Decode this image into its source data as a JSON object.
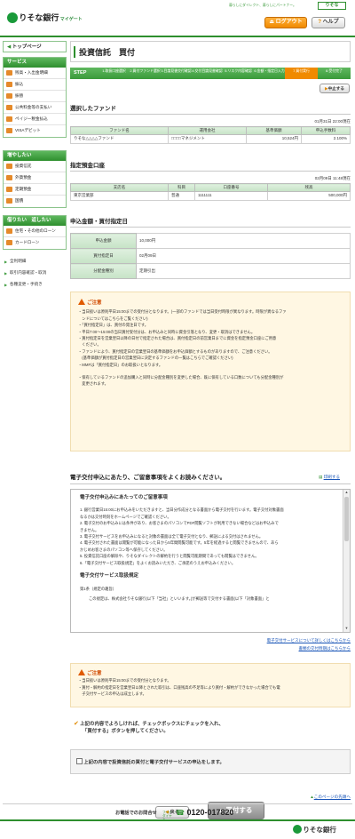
{
  "header": {
    "bank_name": "りそな銀行",
    "service_name": "マイゲート",
    "tagline": "暮らしにダイレクト、暮らしにパートナー。",
    "brand_mark": "りそな",
    "logout_label": "ログアウト",
    "help_label": "ヘルプ"
  },
  "sidebar": {
    "top_page": "トップページ",
    "services_title": "サービス",
    "services": [
      {
        "label": "残高・入出金明細",
        "icon": "yen-passbook-icon"
      },
      {
        "label": "振込",
        "icon": "transfer-icon"
      },
      {
        "label": "振替",
        "icon": "switch-icon"
      },
      {
        "label": "公共料金等の支払い",
        "icon": "bill-icon"
      },
      {
        "label": "ペイジー税金払込",
        "icon": "payeasy-icon"
      },
      {
        "label": "VISAデビット",
        "icon": "card-icon"
      }
    ],
    "increase_title": "増やしたい",
    "increase": [
      {
        "label": "投資信託",
        "icon": "fund-icon"
      },
      {
        "label": "外貨預金",
        "icon": "dollar-icon"
      },
      {
        "label": "定期預金",
        "icon": "deposit-icon"
      },
      {
        "label": "国債",
        "icon": "bond-icon"
      }
    ],
    "borrow_title": "借りたい　返したい",
    "borrow": [
      {
        "label": "住宅・その他のローン",
        "icon": "house-icon"
      },
      {
        "label": "カードローン",
        "icon": "card-loan-icon"
      }
    ],
    "links": [
      "全利明細",
      "取引内容確認・取消",
      "各種変更・手続き"
    ]
  },
  "main": {
    "title": "投資信託　買付",
    "steps_label": "STEP",
    "steps": [
      "1.取扱口座選択",
      "2.買付ファンド選択",
      "3.目論見書交付確認",
      "4.交付目論見書確認",
      "5.リスク内容確認",
      "6.金額・指定日入力",
      "7.買付実行",
      "8.受付完了"
    ],
    "active_step": 6,
    "cancel_label": "中止する",
    "selected_fund": {
      "title": "選択したファンド",
      "timestamp": "01月31日 22:00現在",
      "headers": [
        "ファンド名",
        "運用会社",
        "基準価額",
        "申込手数料"
      ],
      "row": [
        "りそな△△△△ファンド",
        "□□□□マネジメント",
        "10,524円",
        "2.100%"
      ]
    },
    "account": {
      "title": "指定預金口座",
      "timestamp": "02月09日 11:48現在",
      "headers": [
        "支店名",
        "科目",
        "口座番号",
        "残高"
      ],
      "row": [
        "東京営業部",
        "普通",
        "1111111",
        "500,000円"
      ]
    },
    "order": {
      "title": "申込金額・買付指定日",
      "rows": [
        {
          "label": "申込金額",
          "value": "10,000円"
        },
        {
          "label": "買付指定日",
          "value": "02月09日"
        },
        {
          "label": "分配金種別",
          "value": "定期引出"
        }
      ]
    },
    "notice1": {
      "head": "ご注意",
      "lines": [
        "・当日扱いは原則平日15:00までの受付分となります。(一部のファンドでは当日受付時限が異なります。時限が異なるファ",
        "　ンドについてはこちらをご覧ください)",
        "・「買付指定日」は、買付の発注日です。",
        "・平日7:00〜15:00の当日買付受付分は、お申込みと同時に資金引落となり、変更・取消はできません。",
        "・買付指定日を営業翌日以降の日付で指定された場合は、買付指定日の前営業日までに資金を指定預金口座にご用意",
        "　ください。",
        "・ファンドにより、買付指定日の営業翌日の基準価額をお申込価額とするものがありますので、ご注意ください。",
        "　(基準価額が買付指定日の営業翌日に決定するファンドの一覧はこちらでご確認ください)",
        "・MMFは「買付指定日」のお取扱いとなります。",
        "",
        "・保有しているファンドの追加購入と同時に分配金種別を変更した場合、既に保有している口数についても分配金種別が",
        "　変更されます。"
      ]
    },
    "edoc": {
      "title": "電子交付申込にあたり、ご留意事項をよくお読みください。",
      "print_label": "印刷する",
      "inner_title": "電子交付申込みにあたってのご留意事項",
      "lines": [
        "1. 銀行営業日15:00にお申込みをいただきますと、当日分作成分となる書面から電子交付を行います。電子交付対象書面",
        "なるかは交付時刻をホームページでご確認ください。",
        "2. 電子交付のお申込みには条件があり、お客さまのパソコンでPDF閲覧ソフトが利用できない場合などはお申込みで",
        "きません。",
        "3. 電子交付サービスをお申込みになると対象の書面は全て電子交付となり、郵送による交付はされません。",
        "4. 電子交付された書面は閲覧が可能になった日から5年間閲覧可能です。5年を経過すると閲覧できませんので、あら",
        "かじめお客さまのパソコン等へ保存してください。",
        "5. 投資信託口座の解除や、りそなダイレクトの解約を行うと閲覧可能期間であっても閲覧はできません。",
        "6.「電子交付サービス取扱規定」をよくお読みいただき、ご承諾のうえお申込みください。"
      ],
      "rules_title": "電子交付サービス取扱規定",
      "rules_article": "第1条（規定の趣旨）",
      "rules_text": "この規定は、株式会社りそな銀行(以下「当社」といいます。)が郵送等で交付する書面(以下「対象書面」と",
      "link_line1": "電子交付サービスについて詳しくはこちらから",
      "link_line2": "書類の交付時期はこちらから"
    },
    "notice2": {
      "head": "ご注意",
      "lines": [
        "・当日扱いは原則平日15:00までの受付分となります。",
        "・買付・解約の指定日を営業翌日以降とされた取引は、口座残高の不足等により買付・解約ができなかった場合でも電",
        "　子交付サービスの申込は成立します。"
      ]
    },
    "confirm_text1": "上記の内容でよろしければ、チェックボックスにチェックを入れ、",
    "confirm_text2": "「買付する」ボタンを押してください。",
    "checkbox_label": "上記の内容で投資信託の買付と電子交付サービスの申込をします。",
    "back_label": "戻る",
    "submit_label": "買付する",
    "page_top_label": "このページの先頭へ"
  },
  "footer": {
    "contact_label": "お電話でのお問合せ",
    "freedial_label": "フリーダイヤル",
    "phone": "0120-017820",
    "bank_name": "りそな銀行"
  },
  "colors": {
    "brand_green": "#2e8f2e",
    "accent_orange": "#f08a00",
    "notice_bg": "#fff7e3"
  }
}
